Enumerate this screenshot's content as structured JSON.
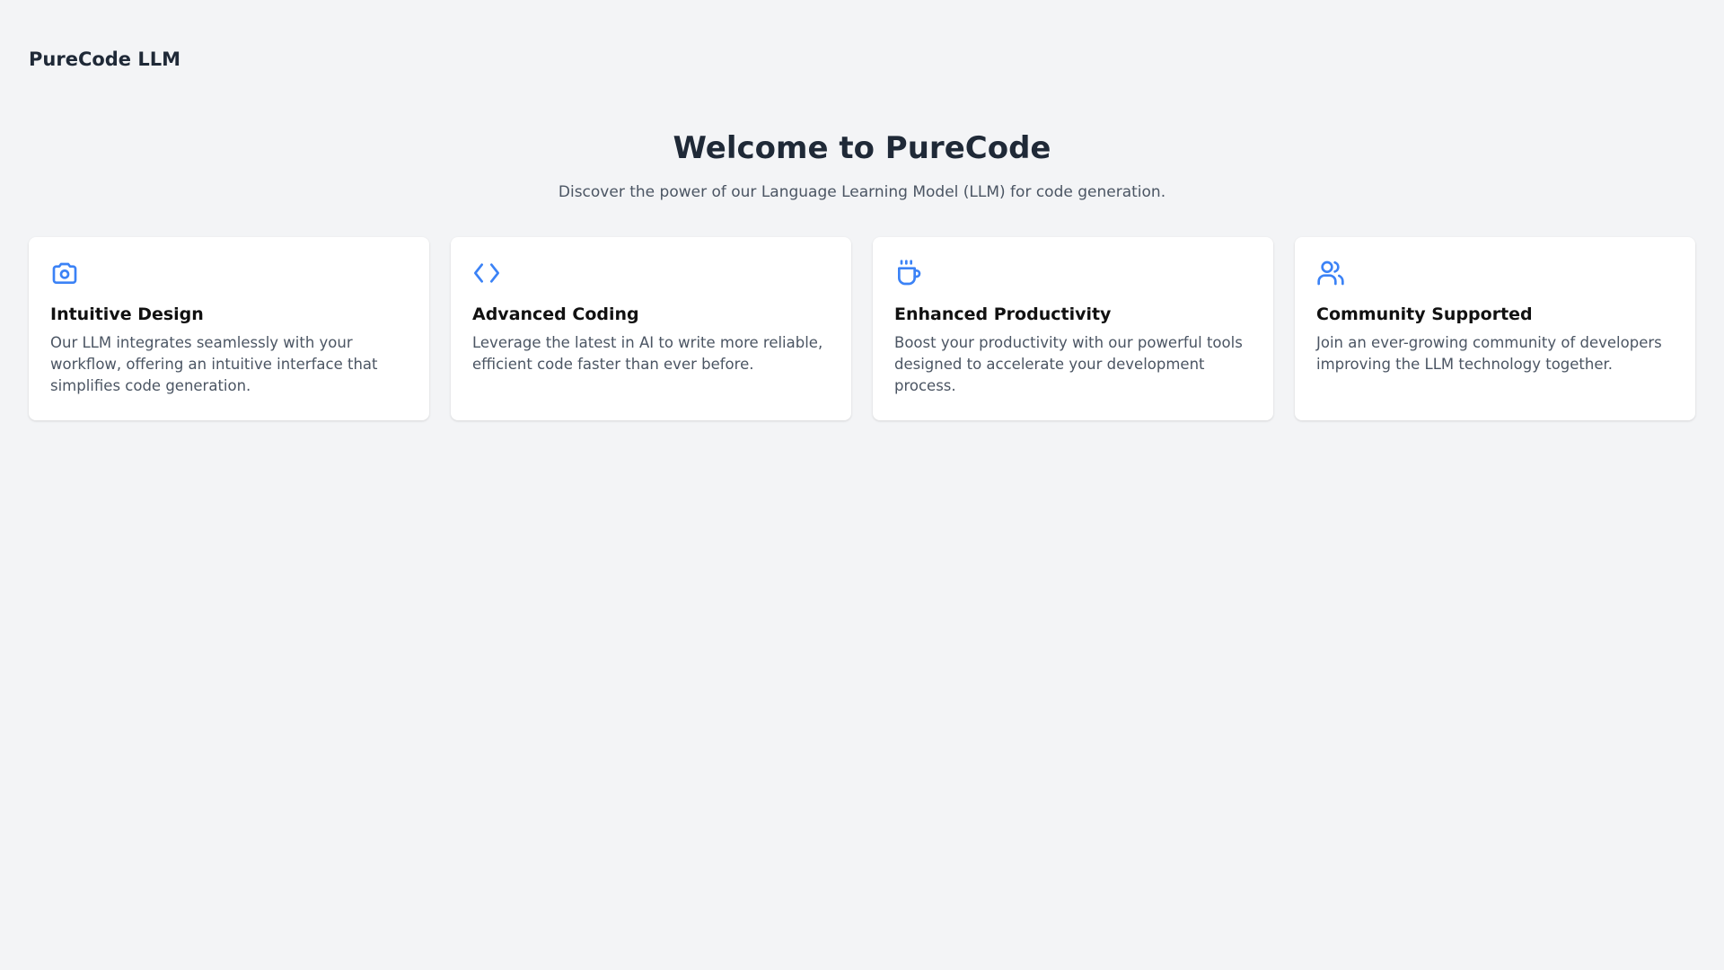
{
  "brand": "PureCode LLM",
  "hero": {
    "title": "Welcome to PureCode",
    "subtitle": "Discover the power of our Language Learning Model (LLM) for code generation."
  },
  "colors": {
    "background": "#f3f4f6",
    "accent": "#3b82f6",
    "card": "#ffffff"
  },
  "features": [
    {
      "icon": "camera-icon",
      "title": "Intuitive Design",
      "description": "Our LLM integrates seamlessly with your workflow, offering an intuitive interface that simplifies code generation."
    },
    {
      "icon": "code-icon",
      "title": "Advanced Coding",
      "description": "Leverage the latest in AI to write more reliable, efficient code faster than ever before."
    },
    {
      "icon": "coffee-icon",
      "title": "Enhanced Productivity",
      "description": "Boost your productivity with our powerful tools designed to accelerate your development process."
    },
    {
      "icon": "users-icon",
      "title": "Community Supported",
      "description": "Join an ever-growing community of developers improving the LLM technology together."
    }
  ]
}
